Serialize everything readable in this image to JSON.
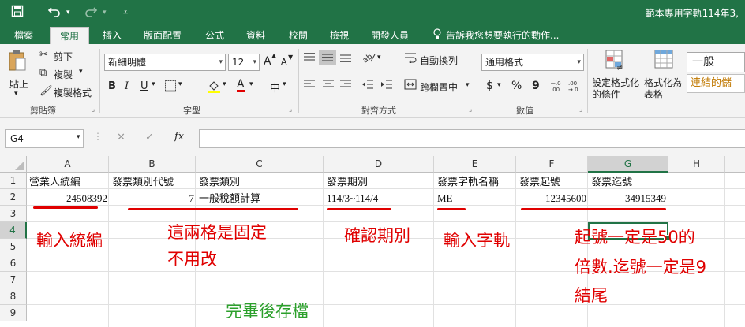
{
  "window": {
    "title": "範本專用字軌114年3,",
    "qat": {
      "save_icon": "save-icon",
      "undo_icon": "undo-icon",
      "redo_icon": "redo-icon",
      "customize_icon": "customize-qat-icon"
    }
  },
  "tabs": [
    {
      "label": "檔案"
    },
    {
      "label": "常用",
      "active": true
    },
    {
      "label": "插入"
    },
    {
      "label": "版面配置"
    },
    {
      "label": "公式"
    },
    {
      "label": "資料"
    },
    {
      "label": "校閱"
    },
    {
      "label": "檢視"
    },
    {
      "label": "開發人員"
    }
  ],
  "tell_me": "告訴我您想要執行的動作...",
  "ribbon": {
    "clipboard": {
      "paste": "貼上",
      "cut": "剪下",
      "copy": "複製",
      "format_painter": "複製格式",
      "label": "剪貼簿"
    },
    "font": {
      "name": "新細明體",
      "size": "12",
      "bold": "B",
      "italic": "I",
      "underline": "U",
      "grow": "A",
      "shrink": "A",
      "font_color": "A",
      "phonetic": "中",
      "label": "字型"
    },
    "alignment": {
      "wrap": "自動換列",
      "merge": "跨欄置中",
      "label": "對齊方式"
    },
    "number": {
      "format": "通用格式",
      "currency": "$",
      "percent": "%",
      "comma": "9",
      "label": "數值"
    },
    "styles": {
      "conditional": "設定格式化的條件",
      "as_table": "格式化為表格",
      "normal": "一般",
      "link": "連結的儲"
    }
  },
  "formula_bar": {
    "name_box": "G4",
    "cancel": "✕",
    "enter": "✓",
    "fx": "fx",
    "value": ""
  },
  "columns": [
    "A",
    "B",
    "C",
    "D",
    "E",
    "F",
    "G",
    "H"
  ],
  "rows": [
    "1",
    "2",
    "3",
    "4",
    "5",
    "6",
    "7",
    "8",
    "9"
  ],
  "cells": {
    "A1": "營業人統編",
    "B1": "發票類別代號",
    "C1": "發票類別",
    "D1": "發票期別",
    "E1": "發票字軌名稱",
    "F1": "發票起號",
    "G1": "發票迄號",
    "A2": "24508392",
    "B2": "7",
    "C2": "一般稅額計算",
    "D2": "114/3~114/4",
    "E2": "ME",
    "F2": "12345600",
    "G2": "34915349"
  },
  "selected_cell": "G4",
  "annotations": {
    "a": "輸入統編",
    "b1": "這兩格是固定",
    "b2": "不用改",
    "c": "確認期別",
    "d": "輸入字軌",
    "e1": "起號一定是50的",
    "e2": "倍數.迄號一定是9",
    "e3": "結尾",
    "save": "完畢後存檔"
  },
  "colors": {
    "excel_green": "#217346",
    "annotation_red": "#e00000",
    "annotation_green": "#2ca02c"
  }
}
